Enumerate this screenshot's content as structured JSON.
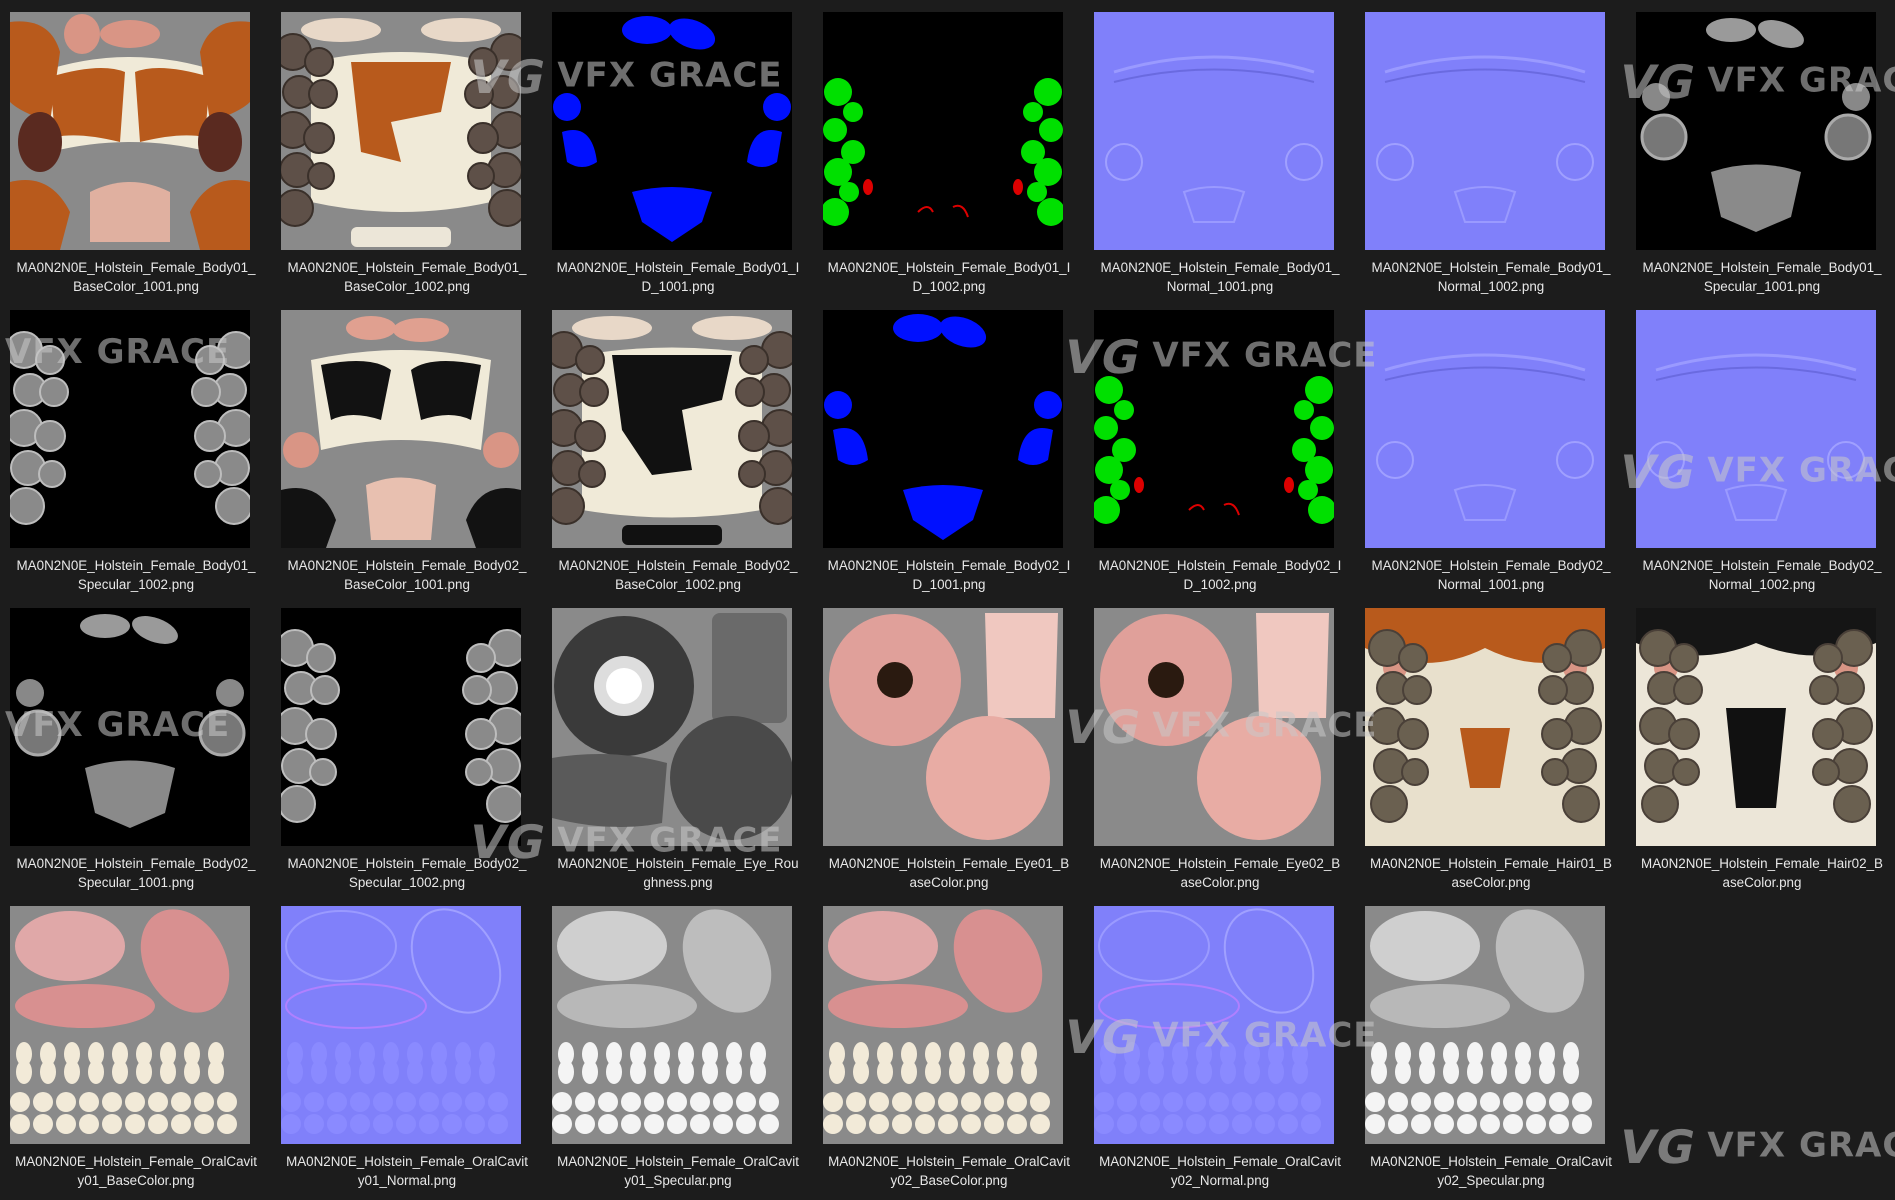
{
  "files": [
    {
      "line1": "MA0N2N0E_Holstein_Female_Body01_",
      "line2": "BaseColor_1001.png",
      "thumb": "body-base-brown"
    },
    {
      "line1": "MA0N2N0E_Holstein_Female_Body01_",
      "line2": "BaseColor_1002.png",
      "thumb": "body-base-brown-spots"
    },
    {
      "line1": "MA0N2N0E_Holstein_Female_Body01_I",
      "line2": "D_1001.png",
      "thumb": "id-blue"
    },
    {
      "line1": "MA0N2N0E_Holstein_Female_Body01_I",
      "line2": "D_1002.png",
      "thumb": "id-green"
    },
    {
      "line1": "MA0N2N0E_Holstein_Female_Body01_",
      "line2": "Normal_1001.png",
      "thumb": "normal"
    },
    {
      "line1": "MA0N2N0E_Holstein_Female_Body01_",
      "line2": "Normal_1002.png",
      "thumb": "normal"
    },
    {
      "line1": "MA0N2N0E_Holstein_Female_Body01_",
      "line2": "Specular_1001.png",
      "thumb": "spec-head"
    },
    {
      "line1": "MA0N2N0E_Holstein_Female_Body01_",
      "line2": "Specular_1002.png",
      "thumb": "spec-balls"
    },
    {
      "line1": "MA0N2N0E_Holstein_Female_Body02_",
      "line2": "BaseColor_1001.png",
      "thumb": "body-base-black"
    },
    {
      "line1": "MA0N2N0E_Holstein_Female_Body02_",
      "line2": "BaseColor_1002.png",
      "thumb": "body-base-black-spots"
    },
    {
      "line1": "MA0N2N0E_Holstein_Female_Body02_I",
      "line2": "D_1001.png",
      "thumb": "id-blue"
    },
    {
      "line1": "MA0N2N0E_Holstein_Female_Body02_I",
      "line2": "D_1002.png",
      "thumb": "id-green"
    },
    {
      "line1": "MA0N2N0E_Holstein_Female_Body02_",
      "line2": "Normal_1001.png",
      "thumb": "normal"
    },
    {
      "line1": "MA0N2N0E_Holstein_Female_Body02_",
      "line2": "Normal_1002.png",
      "thumb": "normal"
    },
    {
      "line1": "MA0N2N0E_Holstein_Female_Body02_",
      "line2": "Specular_1001.png",
      "thumb": "spec-head"
    },
    {
      "line1": "MA0N2N0E_Holstein_Female_Body02_",
      "line2": "Specular_1002.png",
      "thumb": "spec-balls"
    },
    {
      "line1": "MA0N2N0E_Holstein_Female_Eye_Rou",
      "line2": "ghness.png",
      "thumb": "eye-rough"
    },
    {
      "line1": "MA0N2N0E_Holstein_Female_Eye01_B",
      "line2": "aseColor.png",
      "thumb": "eye-base"
    },
    {
      "line1": "MA0N2N0E_Holstein_Female_Eye02_B",
      "line2": "aseColor.png",
      "thumb": "eye-base"
    },
    {
      "line1": "MA0N2N0E_Holstein_Female_Hair01_B",
      "line2": "aseColor.png",
      "thumb": "hair-brown"
    },
    {
      "line1": "MA0N2N0E_Holstein_Female_Hair02_B",
      "line2": "aseColor.png",
      "thumb": "hair-black"
    },
    {
      "line1": "MA0N2N0E_Holstein_Female_OralCavit",
      "line2": "y01_BaseColor.png",
      "thumb": "oral-base"
    },
    {
      "line1": "MA0N2N0E_Holstein_Female_OralCavit",
      "line2": "y01_Normal.png",
      "thumb": "oral-normal"
    },
    {
      "line1": "MA0N2N0E_Holstein_Female_OralCavit",
      "line2": "y01_Specular.png",
      "thumb": "oral-spec"
    },
    {
      "line1": "MA0N2N0E_Holstein_Female_OralCavit",
      "line2": "y02_BaseColor.png",
      "thumb": "oral-base"
    },
    {
      "line1": "MA0N2N0E_Holstein_Female_OralCavit",
      "line2": "y02_Normal.png",
      "thumb": "oral-normal"
    },
    {
      "line1": "MA0N2N0E_Holstein_Female_OralCavit",
      "line2": "y02_Specular.png",
      "thumb": "oral-spec"
    }
  ],
  "watermark": {
    "text": "VFX GRACE",
    "mark": "VG"
  },
  "colors": {
    "background": "#1c1c1c",
    "caption": "#e8e8e8",
    "normal_map": "#8080fa",
    "id_blue": "#0010ff",
    "id_green": "#00e000",
    "hide_brown": "#b85a1c",
    "gray_bg": "#8a8a8a"
  }
}
